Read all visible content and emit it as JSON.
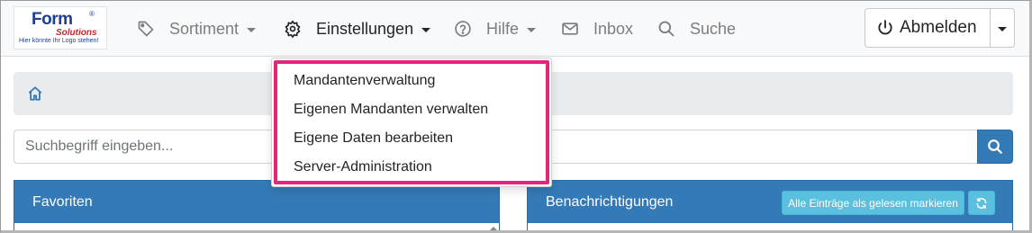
{
  "logo": {
    "brand": "Form",
    "registered": "®",
    "sub": "Solutions",
    "tagline": "Hier könnte Ihr Logo stehen!"
  },
  "nav": {
    "sortiment": "Sortiment",
    "einstellungen": "Einstellungen",
    "hilfe": "Hilfe",
    "inbox": "Inbox",
    "suche": "Suche",
    "logout": "Abmelden"
  },
  "dropdown": {
    "items": [
      "Mandantenverwaltung",
      "Eigenen Mandanten verwalten",
      "Eigene Daten bearbeiten",
      "Server-Administration"
    ]
  },
  "search": {
    "placeholder": "Suchbegriff eingeben..."
  },
  "panels": {
    "favorites_title": "Favoriten",
    "notifications_title": "Benachrichtigungen",
    "mark_all_read": "Alle Einträge als gelesen markieren"
  },
  "colors": {
    "primary": "#337ab7",
    "info": "#5bc0de",
    "highlight": "#e3267b",
    "muted_nav": "#7d7d7d"
  },
  "icons": {
    "sortiment": "tag-icon",
    "einstellungen": "gear-icon",
    "hilfe": "question-circle-icon",
    "inbox": "envelope-icon",
    "suche": "search-icon",
    "logout": "power-icon",
    "breadcrumb": "home-icon",
    "refresh": "refresh-icon"
  }
}
